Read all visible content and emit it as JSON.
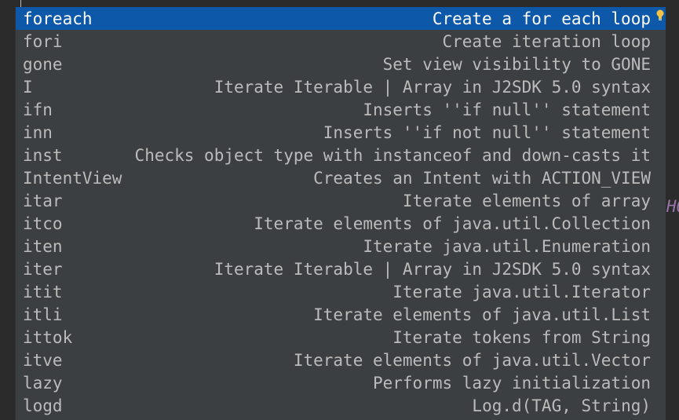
{
  "background_code_fragment": "HO",
  "items": [
    {
      "abbr": "foreach",
      "desc": "Create a for each loop",
      "selected": true
    },
    {
      "abbr": "fori",
      "desc": "Create iteration loop"
    },
    {
      "abbr": "gone",
      "desc": "Set view visibility to GONE"
    },
    {
      "abbr": "I",
      "desc": "Iterate Iterable | Array in J2SDK 5.0 syntax"
    },
    {
      "abbr": "ifn",
      "desc": "Inserts ''if null'' statement"
    },
    {
      "abbr": "inn",
      "desc": "Inserts ''if not null'' statement"
    },
    {
      "abbr": "inst",
      "desc": "Checks object type with instanceof and down-casts it"
    },
    {
      "abbr": "IntentView",
      "desc": "Creates an Intent with ACTION_VIEW"
    },
    {
      "abbr": "itar",
      "desc": "Iterate elements of array"
    },
    {
      "abbr": "itco",
      "desc": "Iterate elements of java.util.Collection"
    },
    {
      "abbr": "iten",
      "desc": "Iterate java.util.Enumeration"
    },
    {
      "abbr": "iter",
      "desc": "Iterate Iterable | Array in J2SDK 5.0 syntax"
    },
    {
      "abbr": "itit",
      "desc": "Iterate java.util.Iterator"
    },
    {
      "abbr": "itli",
      "desc": "Iterate elements of java.util.List"
    },
    {
      "abbr": "ittok",
      "desc": "Iterate tokens from String"
    },
    {
      "abbr": "itve",
      "desc": "Iterate elements of java.util.Vector"
    },
    {
      "abbr": "lazy",
      "desc": "Performs lazy initialization"
    },
    {
      "abbr": "logd",
      "desc": "Log.d(TAG, String)"
    }
  ],
  "icons": {
    "selected_row_hint": "lightbulb-icon"
  },
  "colors": {
    "selection": "#0d58a8",
    "popup_bg": "#3c3f41",
    "text": "#bbbbbb",
    "editor_bg": "#2b2b2b",
    "bulb": "#f5c242"
  }
}
